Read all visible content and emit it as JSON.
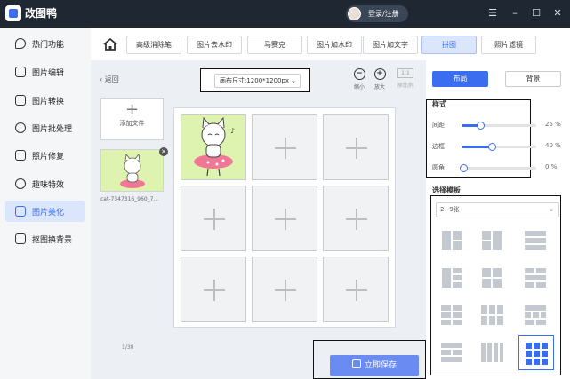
{
  "app": {
    "name": "改图鸭",
    "login_label": "登录/注册"
  },
  "window_controls": [
    "menu-icon",
    "minimize-icon",
    "maximize-icon",
    "close-icon"
  ],
  "sidebar": {
    "items": [
      {
        "label": "热门功能",
        "icon": "fire-icon",
        "active": false
      },
      {
        "label": "图片编辑",
        "icon": "image-edit-icon",
        "active": false
      },
      {
        "label": "图片转换",
        "icon": "convert-icon",
        "active": false
      },
      {
        "label": "图片批处理",
        "icon": "batch-icon",
        "active": false
      },
      {
        "label": "照片修复",
        "icon": "repair-icon",
        "active": false
      },
      {
        "label": "趣味特效",
        "icon": "effects-icon",
        "active": false
      },
      {
        "label": "图片美化",
        "icon": "beautify-icon",
        "active": true
      },
      {
        "label": "抠图换背景",
        "icon": "cutout-icon",
        "active": false
      }
    ]
  },
  "toolbar": {
    "tabs": [
      {
        "label": "高级消除笔",
        "active": false
      },
      {
        "label": "图片去水印",
        "active": false
      },
      {
        "label": "马赛克",
        "active": false
      },
      {
        "label": "图片加水印",
        "active": false
      },
      {
        "label": "图片加文字",
        "active": false
      },
      {
        "label": "拼图",
        "active": true
      },
      {
        "label": "照片滤镜",
        "active": false
      }
    ]
  },
  "workspace": {
    "back_label": "返回",
    "canvas_size_label": "画布尺寸:1200*1200px",
    "zoom_out_label": "缩小",
    "zoom_in_label": "放大",
    "original_label": "原比例",
    "original_badge": "1:1",
    "add_file_label": "添加文件",
    "file_name": "cat-7347316_960_7...",
    "page_count": "1/30",
    "save_label": "立即保存"
  },
  "grid": {
    "rows": 3,
    "cols": 3,
    "filled_index": 0
  },
  "panel": {
    "tab_layout": "布局",
    "tab_background": "背景",
    "style_title": "样式",
    "sliders": [
      {
        "label": "间距",
        "value": 25,
        "value_text": "25 %"
      },
      {
        "label": "边框",
        "value": 40,
        "value_text": "40 %"
      },
      {
        "label": "圆角",
        "value": 0,
        "value_text": "0 %"
      }
    ],
    "template_title": "选择模板",
    "template_select": "2~9张",
    "selected_template_index": 11
  },
  "colors": {
    "accent": "#3a6df0",
    "titlebar": "#1f2733",
    "photo_bg": "#dff3b0"
  }
}
